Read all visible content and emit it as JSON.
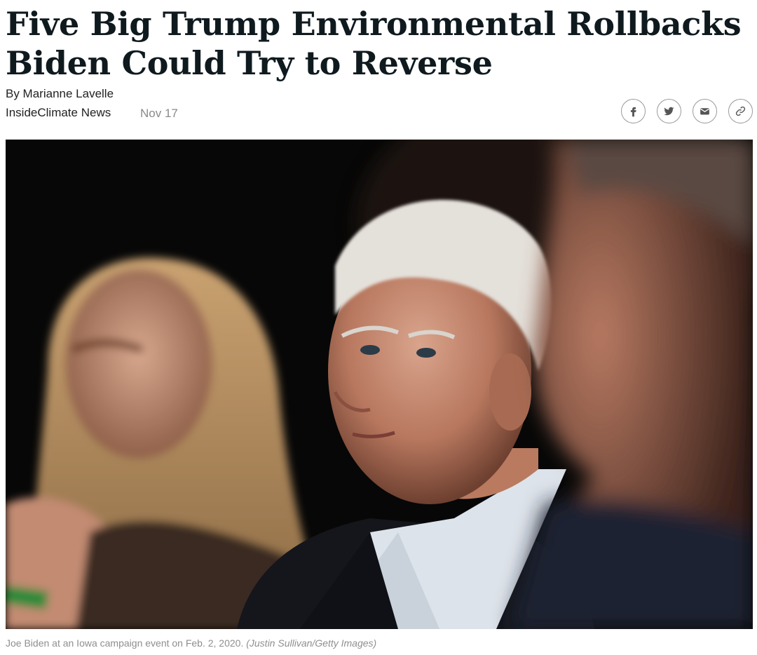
{
  "article": {
    "headline": "Five Big Trump Environmental Rollbacks Biden Could Try to Reverse",
    "byline": "By Marianne Lavelle",
    "source": "InsideClimate News",
    "date": "Nov 17"
  },
  "share": {
    "icons": [
      "facebook-icon",
      "twitter-icon",
      "email-icon",
      "link-icon"
    ]
  },
  "photo": {
    "caption": "Joe Biden at an Iowa campaign event on Feb. 2, 2020.",
    "credit": "(Justin Sullivan/Getty Images)"
  },
  "colors": {
    "headline": "#0f1a1f",
    "meta_gray": "#8a8a8a",
    "caption_gray": "#8f8f8f",
    "icon_border": "#9a9a9a"
  }
}
